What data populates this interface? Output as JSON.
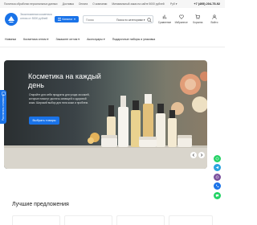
{
  "topbar": {
    "links": [
      "Политика обработки персональных данных",
      "Доставка",
      "Оплата",
      "О компании",
      "Минимальный заказ на сайте 5000 рублей"
    ],
    "currency": "Руб",
    "phone": "+7 (495) 204-75-92"
  },
  "header": {
    "slogan": "Эксклюзивная косметика оптом от 5000 рублей",
    "catalog_label": "Каталог",
    "search": {
      "placeholder": "Поиск",
      "category": "Поиск по категориям"
    },
    "icons": [
      {
        "name": "compare",
        "label": "Сравнение"
      },
      {
        "name": "favorites",
        "label": "Избранное"
      },
      {
        "name": "cart",
        "label": "Корзина"
      },
      {
        "name": "account",
        "label": "Войти"
      }
    ]
  },
  "nav": {
    "items": [
      "Новинки",
      "Косметика оптом",
      "Закажите оптом",
      "Аксессуары",
      "Подарочные наборы и упаковка"
    ]
  },
  "hero": {
    "title": "Косметика на каждый день",
    "description": "Откройте для себя продукты для ухода за кожей, которые помогут достичь сияющей и здоровой кожи. Широкий выбор для типа кожи и проблем.",
    "button": "Выбрать товары"
  },
  "sidetab": {
    "label": "Рассчитать стоимость"
  },
  "section": {
    "title": "Лучшие предложения"
  },
  "colors": {
    "accent": "#1a73e8",
    "whatsapp": "#25d366",
    "telegram": "#2aa3df",
    "viber": "#7b519d",
    "phone": "#1a73e8"
  }
}
